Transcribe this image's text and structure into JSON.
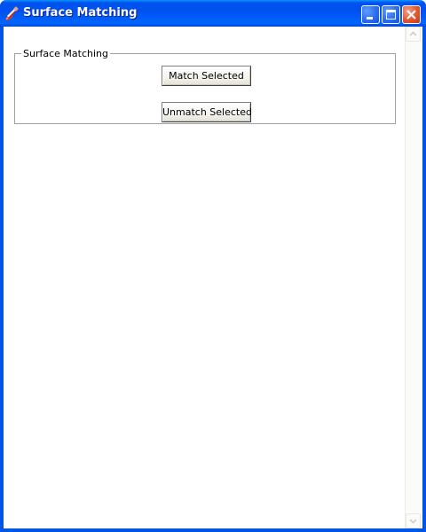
{
  "window": {
    "title": "Surface Matching",
    "icon": "pencil-app-icon",
    "controls": [
      "minimize-icon",
      "maximize-icon",
      "close-icon"
    ],
    "colors": {
      "titlebar": "#0055E5",
      "close": "#E2572C",
      "client_bg": "#ffffff"
    }
  },
  "group": {
    "label": "Surface Matching"
  },
  "buttons": {
    "match_label": "Match Selected",
    "unmatch_label": "Unmatch Selected"
  },
  "scrollbar": {
    "up_icon": "scroll-up-arrow-icon",
    "down_icon": "scroll-down-arrow-icon"
  }
}
